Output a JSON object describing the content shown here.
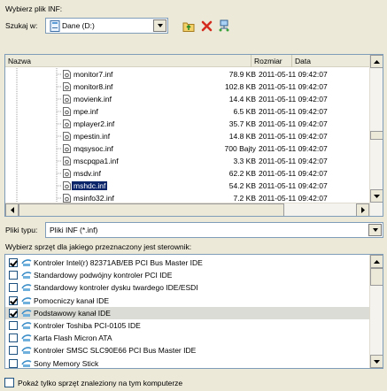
{
  "dialog": {
    "title_label": "Wybierz plik INF:",
    "look_in_label": "Szukaj w:",
    "look_in_value": "Dane (D:)",
    "file_type_label": "Pliki typu:",
    "file_type_value": "Pliki INF (*.inf)",
    "hardware_label": "Wybierz sprzęt dla jakiego przeznaczony jest sterownik:",
    "show_only_label": "Pokaż tylko sprzęt znaleziony na tym komputerze",
    "show_only_checked": false
  },
  "file_list": {
    "headers": [
      "Nazwa",
      "Rozmiar",
      "Data"
    ],
    "rows": [
      {
        "name": "monitor7.inf",
        "size": "78.9 KB",
        "date": "2011-05-11 09:42:07"
      },
      {
        "name": "monitor8.inf",
        "size": "102.8 KB",
        "date": "2011-05-11 09:42:07"
      },
      {
        "name": "movienk.inf",
        "size": "14.4 KB",
        "date": "2011-05-11 09:42:07"
      },
      {
        "name": "mpe.inf",
        "size": "6.5 KB",
        "date": "2011-05-11 09:42:07"
      },
      {
        "name": "mplayer2.inf",
        "size": "35.7 KB",
        "date": "2011-05-11 09:42:07"
      },
      {
        "name": "mpestin.inf",
        "size": "14.8 KB",
        "date": "2011-05-11 09:42:07"
      },
      {
        "name": "mqsysoc.inf",
        "size": "700 Bajty",
        "date": "2011-05-11 09:42:07"
      },
      {
        "name": "mscpqpa1.inf",
        "size": "3.3 KB",
        "date": "2011-05-11 09:42:07"
      },
      {
        "name": "msdv.inf",
        "size": "62.2 KB",
        "date": "2011-05-11 09:42:07"
      },
      {
        "name": "mshdc.inf",
        "size": "54.2 KB",
        "date": "2011-05-11 09:42:07"
      },
      {
        "name": "msinfo32.inf",
        "size": "7.2 KB",
        "date": "2011-05-11 09:42:07"
      }
    ],
    "selected_index": 9
  },
  "hardware_list": [
    {
      "label": "Kontroler Intel(r) 82371AB/EB PCI Bus Master IDE",
      "checked": true
    },
    {
      "label": "Standardowy podwójny kontroler PCI IDE",
      "checked": false
    },
    {
      "label": "Standardowy kontroler dysku twardego IDE/ESDI",
      "checked": false
    },
    {
      "label": "Pomocniczy kanał IDE",
      "checked": true
    },
    {
      "label": "Podstawowy kanał IDE",
      "checked": true
    },
    {
      "label": "Kontroler Toshiba PCI-0105 IDE",
      "checked": false
    },
    {
      "label": "Karta Flash Micron ATA",
      "checked": false
    },
    {
      "label": "Kontroler SMSC SLC90E66 PCI Bus Master IDE",
      "checked": false
    },
    {
      "label": "Sony Memory Stick",
      "checked": false
    }
  ],
  "hardware_selected_index": 4,
  "toolbar_icons": [
    "folder-up-icon",
    "delete-icon",
    "network-icon"
  ]
}
